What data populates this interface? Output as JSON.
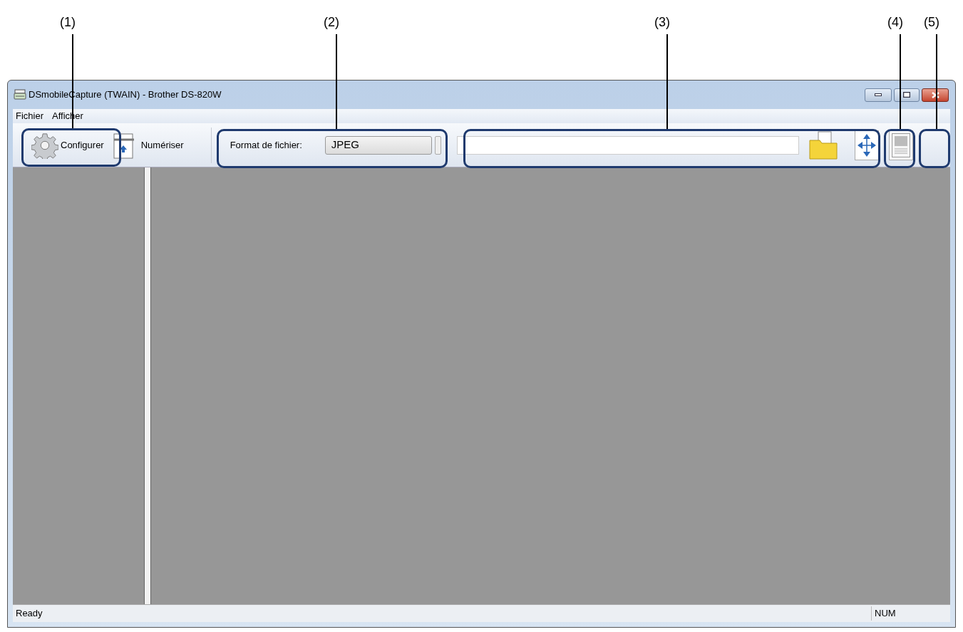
{
  "callouts": [
    {
      "label": "(1)"
    },
    {
      "label": "(2)"
    },
    {
      "label": "(3)"
    },
    {
      "label": "(4)"
    },
    {
      "label": "(5)"
    }
  ],
  "window": {
    "title": "DSmobileCapture (TWAIN) - Brother DS-820W"
  },
  "menu": [
    "Fichier",
    "Afficher"
  ],
  "toolbar": {
    "configure": "Configurer",
    "scan": "Numériser",
    "format_label": "Format de fichier:",
    "format_value": "JPEG"
  },
  "status_bar": {
    "text": "Ready",
    "num": "NUM"
  }
}
